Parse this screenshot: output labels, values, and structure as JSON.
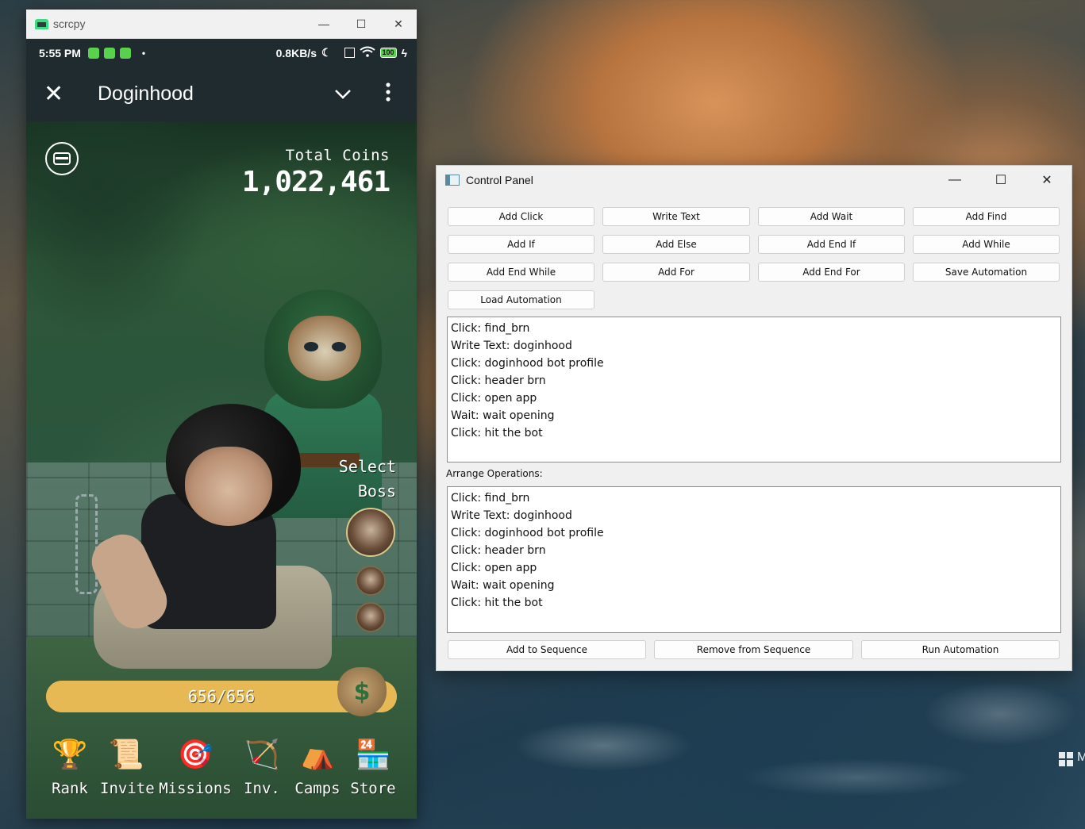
{
  "desktop": {
    "corner_text": "M"
  },
  "scrcpy": {
    "title": "scrcpy",
    "controls": {
      "minimize": "—",
      "maximize": "☐",
      "close": "✕"
    },
    "status_bar": {
      "time": "5:55 PM",
      "dot": "•",
      "speed": "0.8KB/s",
      "moon": "☾",
      "battery": "100",
      "bolt": "ϟ"
    },
    "app_header": {
      "close": "✕",
      "title": "Doginhood",
      "chevron": "⌄",
      "more": "⋮"
    },
    "game": {
      "total_coins_label": "Total Coins",
      "total_coins_value": "1,022,461",
      "select_boss_lines": [
        "Select",
        "Boss"
      ],
      "energy_text": "656/656",
      "energy_fraction": 1.0,
      "money_bag_glyph": "$",
      "nav": [
        {
          "icon": "🏆",
          "label": "Rank"
        },
        {
          "icon": "📜",
          "label": "Invite"
        },
        {
          "icon": "🎯",
          "label": "Missions"
        },
        {
          "icon": "🏹",
          "label": "Inv."
        },
        {
          "icon": "⛺",
          "label": "Camps"
        },
        {
          "icon": "🏪",
          "label": "Store"
        }
      ]
    }
  },
  "control_panel": {
    "title": "Control Panel",
    "controls": {
      "minimize": "—",
      "maximize": "☐",
      "close": "✕"
    },
    "buttons": {
      "add_click": "Add Click",
      "write_text": "Write Text",
      "add_wait": "Add Wait",
      "add_find": "Add Find",
      "add_if": "Add If",
      "add_else": "Add Else",
      "add_end_if": "Add End If",
      "add_while": "Add While",
      "add_end_while": "Add End While",
      "add_for": "Add For",
      "add_end_for": "Add End For",
      "save_automation": "Save Automation",
      "load_automation": "Load Automation",
      "add_to_sequence": "Add to Sequence",
      "remove_from_sequence": "Remove from Sequence",
      "run_automation": "Run Automation"
    },
    "operations": [
      "Click: find_brn",
      "Write Text: doginhood",
      "Click: doginhood bot profile",
      "Click: header brn",
      "Click: open app",
      "Wait: wait opening",
      "Click: hit the bot"
    ],
    "arrange_label": "Arrange Operations:",
    "arranged": [
      "Click: find_brn",
      "Write Text: doginhood",
      "Click: doginhood bot profile",
      "Click: header brn",
      "Click: open app",
      "Wait: wait opening",
      "Click: hit the bot"
    ]
  }
}
